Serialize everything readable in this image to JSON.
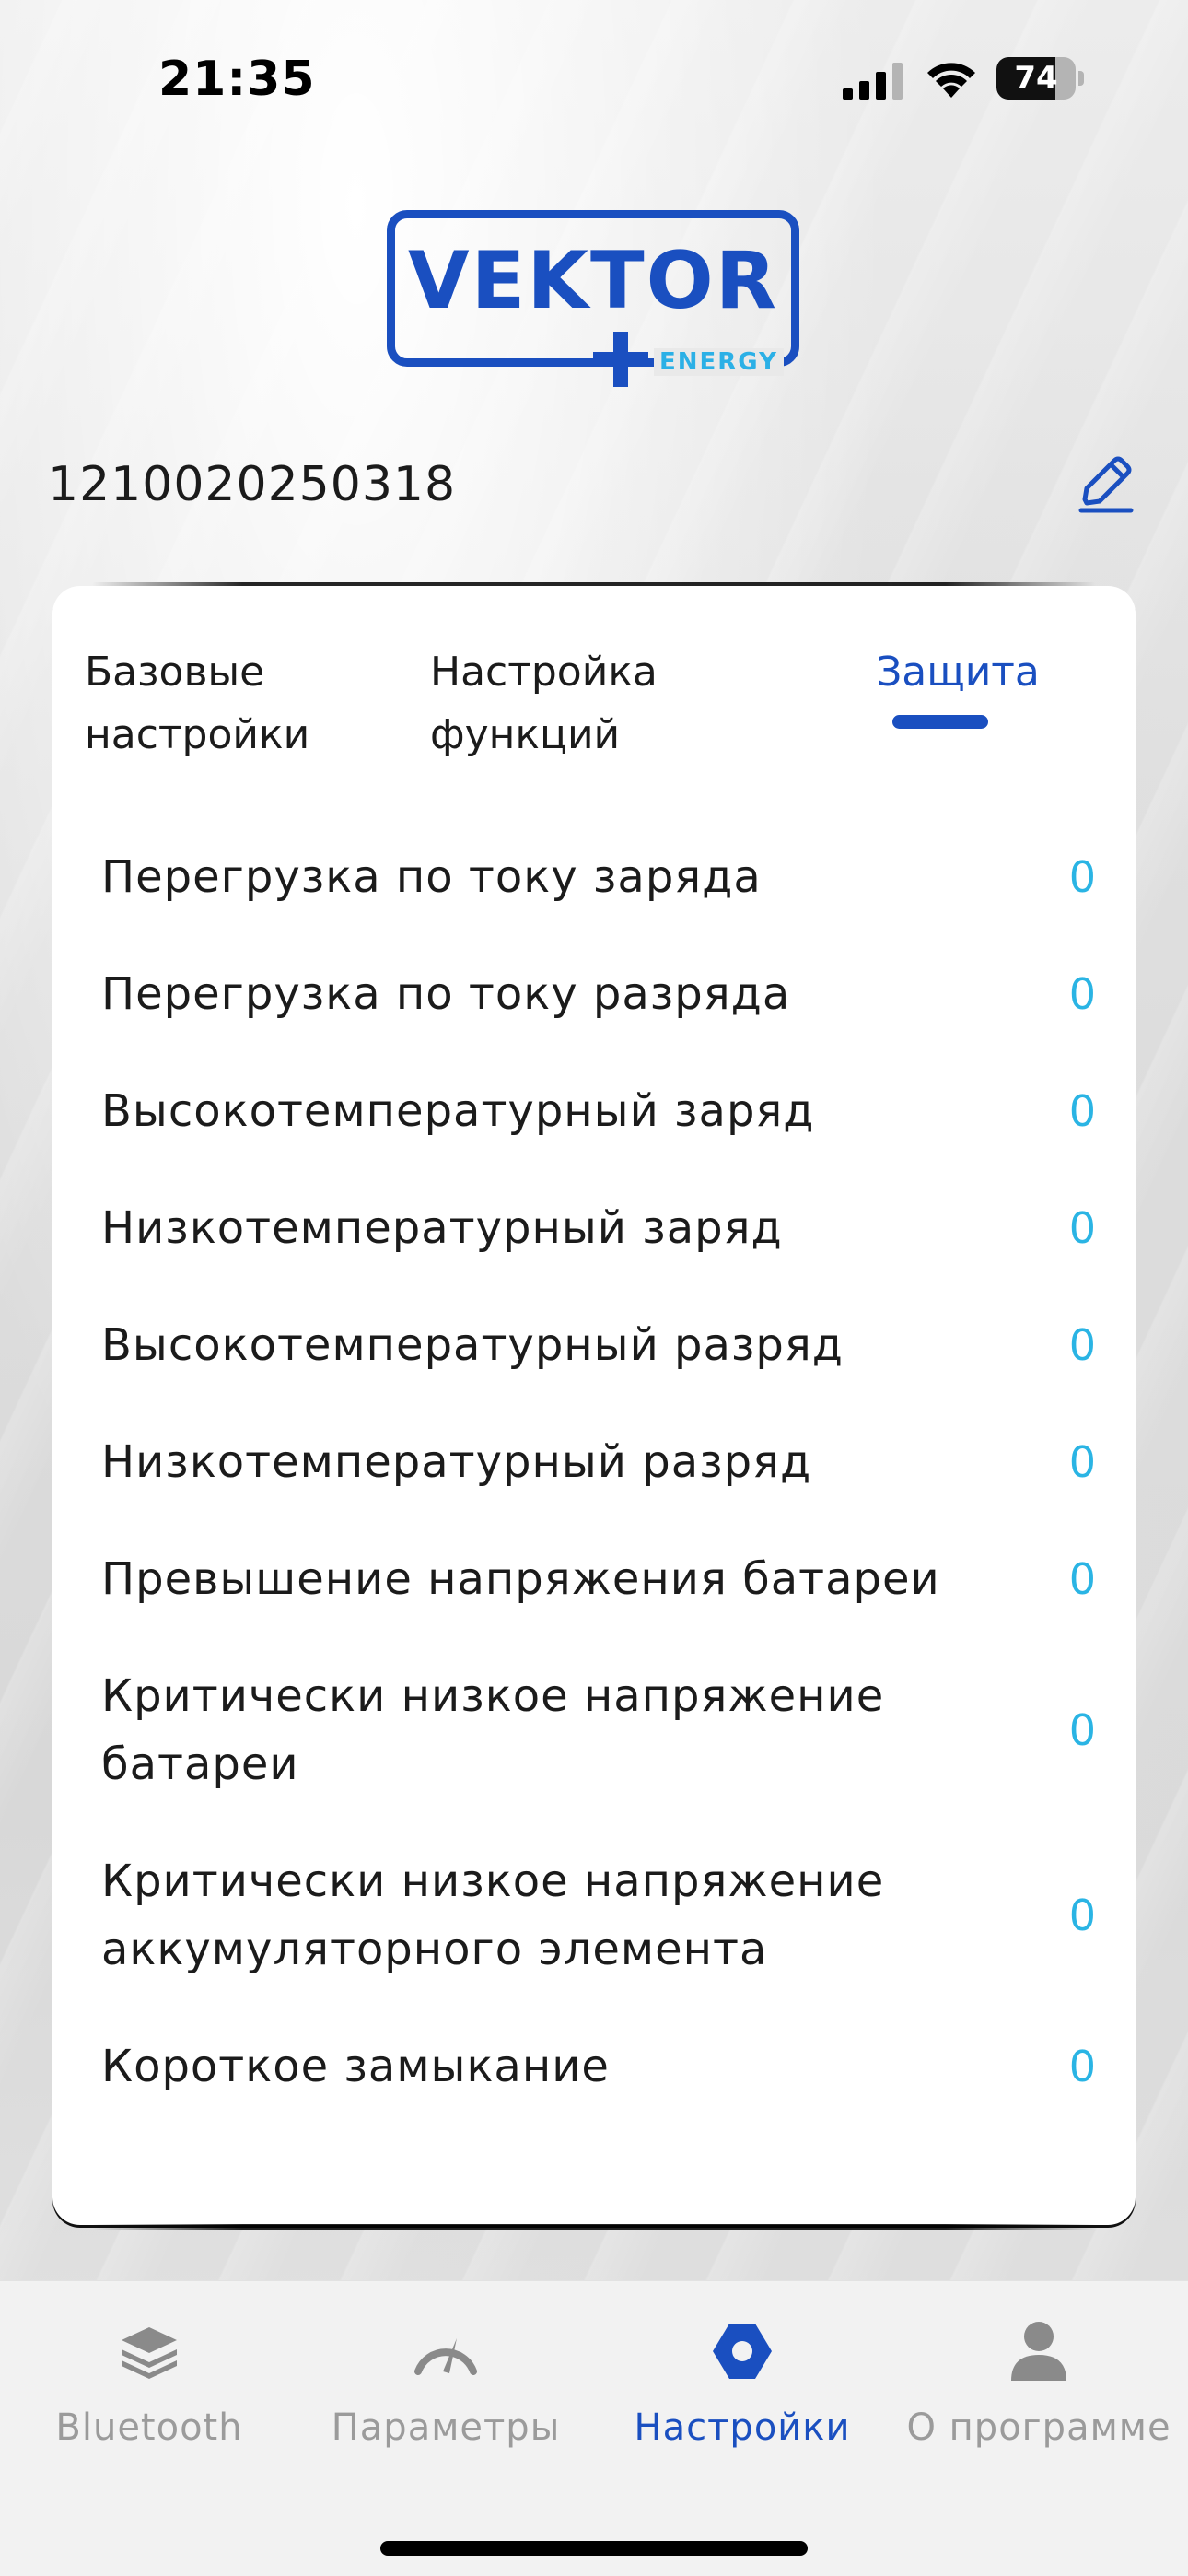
{
  "status_bar": {
    "time": "21:35",
    "battery_level": "74",
    "icons": [
      "signal-icon",
      "wifi-icon",
      "battery-icon"
    ]
  },
  "logo": {
    "main_text": "VEKTOR",
    "sub_text": "ENERGY",
    "color": "#1a4fc0",
    "accent": "#2bb0e6"
  },
  "device": {
    "id": "1210020250318",
    "edit_icon": "pencil-icon"
  },
  "tabs": [
    {
      "label_line1": "Базовые",
      "label_line2": "настройки",
      "active": false
    },
    {
      "label_line1": "Настройка",
      "label_line2": "функций",
      "active": false
    },
    {
      "label_line1": "Защита",
      "label_line2": "",
      "active": true
    }
  ],
  "protection_items": [
    {
      "label": "Перегрузка по току заряда",
      "value": "0"
    },
    {
      "label": "Перегрузка по току разряда",
      "value": "0"
    },
    {
      "label": "Высокотемпературный заряд",
      "value": "0"
    },
    {
      "label": "Низкотемпературный заряд",
      "value": "0"
    },
    {
      "label": "Высокотемпературный разряд",
      "value": "0"
    },
    {
      "label": "Низкотемпературный разряд",
      "value": "0"
    },
    {
      "label": "Превышение напряжения батареи",
      "value": "0"
    },
    {
      "label": "Критически низкое напряжение батареи",
      "value": "0"
    },
    {
      "label": "Критически низкое напряжение аккумуляторного элемента",
      "value": "0"
    },
    {
      "label": "Короткое замыкание",
      "value": "0"
    }
  ],
  "tabbar": [
    {
      "label": "Bluetooth",
      "icon": "layers-icon",
      "active": false
    },
    {
      "label": "Параметры",
      "icon": "gauge-icon",
      "active": false
    },
    {
      "label": "Настройки",
      "icon": "hexagon-settings-icon",
      "active": true
    },
    {
      "label": "О программе",
      "icon": "user-icon",
      "active": false
    }
  ],
  "colors": {
    "accent": "#1a4fc0",
    "value": "#2ab4e4",
    "inactive": "#9b9b9b"
  }
}
